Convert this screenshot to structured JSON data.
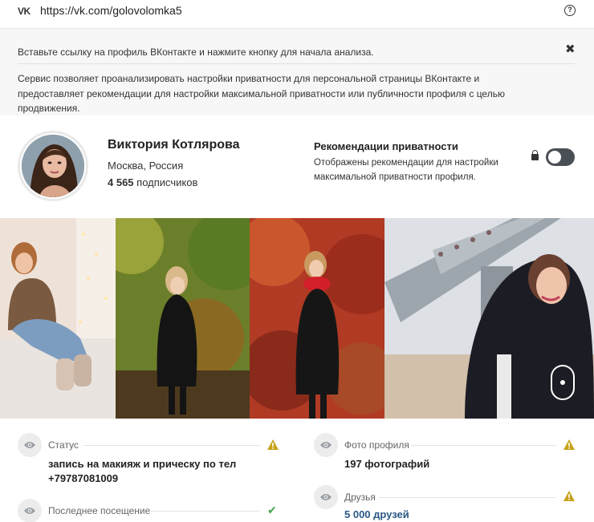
{
  "browser": {
    "logo": "VK",
    "url": "https://vk.com/golovolomka5",
    "help_icon": "?"
  },
  "info": {
    "line1": "Вставьте ссылку на профиль ВКонтакте и нажмите кнопку для начала анализа.",
    "close": "✖",
    "description": "Сервис позволяет проанализировать настройки приватности для персональной страницы ВКонтакте и предоставляет рекомендации для настройки максимальной приватности или публичности профиля с целью продвижения."
  },
  "profile": {
    "name": "Виктория Котлярова",
    "city": "Москва, Россия",
    "subscribers_count": "4 565",
    "subscribers_label": "подписчиков"
  },
  "recommendations": {
    "title": "Рекомендации приватности",
    "description": "Отображены рекомендации для настройки максимальной приватности профиля.",
    "toggle_on": false
  },
  "stats": {
    "status": {
      "label": "Статус",
      "value": "запись на макияж и прическу по тел +79787081009",
      "indicator": "warning"
    },
    "last_visit": {
      "label": "Последнее посещение",
      "indicator": "ok"
    },
    "photos": {
      "label": "Фото профиля",
      "value": "197 фотографий",
      "indicator": "warning"
    },
    "friends": {
      "label": "Друзья",
      "value": "5 000 друзей",
      "indicator": "warning"
    }
  },
  "colors": {
    "warning": "#c8a21a",
    "ok": "#3fa34d",
    "link": "#2a5885",
    "toggle": "#4a4f55"
  }
}
